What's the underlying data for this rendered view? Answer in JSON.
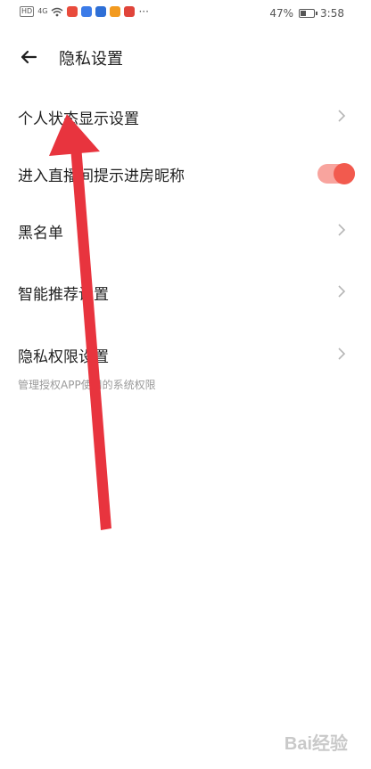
{
  "status_bar": {
    "left_badge": "HD",
    "signal_label": "4G",
    "dots": "···",
    "battery_percent": "47%",
    "battery_level": 0.47,
    "time": "3:58"
  },
  "header": {
    "title": "隐私设置"
  },
  "rows": [
    {
      "label": "个人状态显示设置"
    },
    {
      "label": "进入直播间提示进房昵称",
      "toggle_on": true
    },
    {
      "label": "黑名单"
    },
    {
      "label": "智能推荐设置"
    },
    {
      "label": "隐私权限设置",
      "sub": "管理授权APP使用的系统权限"
    }
  ],
  "watermark": "Bai经验",
  "colors": {
    "toggle_track": "#f8a49e",
    "toggle_knob": "#f25a4e",
    "annotation_arrow": "#e8343e"
  }
}
